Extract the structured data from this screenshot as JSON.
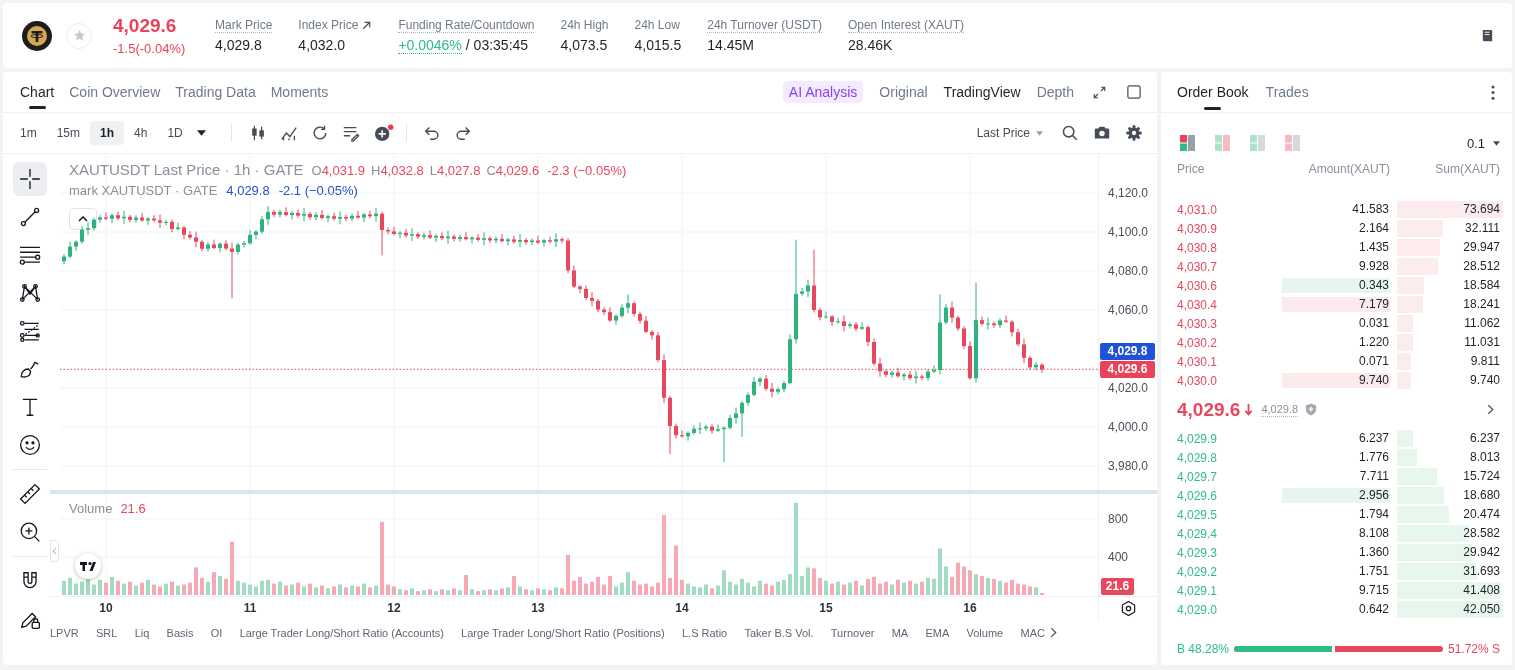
{
  "header": {
    "price": "4,029.6",
    "change": "-1.5(-0.04%)",
    "stats": [
      {
        "kind": "plain",
        "label": "Mark Price",
        "value": "4,029.8",
        "underlined": true
      },
      {
        "kind": "link",
        "label": "Index Price",
        "value": "4,032.0",
        "underlined": false
      },
      {
        "kind": "funding",
        "label": "Funding Rate/Countdown",
        "rate": "+0.0046%",
        "countdown": "/ 03:35:45",
        "underlined": true
      },
      {
        "kind": "plain",
        "label": "24h High",
        "value": "4,073.5",
        "underlined": false
      },
      {
        "kind": "plain",
        "label": "24h Low",
        "value": "4,015.5",
        "underlined": false
      },
      {
        "kind": "plain",
        "label": "24h Turnover (USDT)",
        "value": "14.45M",
        "underlined": true
      },
      {
        "kind": "plain",
        "label": "Open Interest (XAUT)",
        "value": "28.46K",
        "underlined": true
      }
    ]
  },
  "chart_panel": {
    "tabs": [
      {
        "label": "Chart",
        "selected": true
      },
      {
        "label": "Coin Overview",
        "selected": false
      },
      {
        "label": "Trading Data",
        "selected": false
      },
      {
        "label": "Moments",
        "selected": false
      }
    ],
    "ai_button": "AI Analysis",
    "views": [
      {
        "label": "Original",
        "selected": false
      },
      {
        "label": "TradingView",
        "selected": true
      },
      {
        "label": "Depth",
        "selected": false
      }
    ],
    "intervals": [
      {
        "label": "1m",
        "selected": false
      },
      {
        "label": "15m",
        "selected": false
      },
      {
        "label": "1h",
        "selected": true
      },
      {
        "label": "4h",
        "selected": false
      },
      {
        "label": "1D",
        "selected": false
      }
    ],
    "price_source": "Last Price",
    "left_tool_groups": [
      [
        {
          "kind": "crosshair",
          "selected": true
        },
        {
          "kind": "trend-line",
          "selected": false
        },
        {
          "kind": "horizontal-lines",
          "selected": false
        },
        {
          "kind": "pattern",
          "selected": false
        },
        {
          "kind": "fib-levels",
          "selected": false
        },
        {
          "kind": "brush",
          "selected": false
        },
        {
          "kind": "text",
          "selected": false
        },
        {
          "kind": "emoji",
          "selected": false
        }
      ],
      [
        {
          "kind": "ruler",
          "selected": false
        },
        {
          "kind": "zoom-in",
          "selected": false
        }
      ],
      [
        {
          "kind": "magnet",
          "selected": false
        },
        {
          "kind": "lock-drawing",
          "selected": false
        }
      ]
    ],
    "legend": {
      "ohlc": [
        {
          "key": "O",
          "value": "4,031.9"
        },
        {
          "key": "H",
          "value": "4,032.8"
        },
        {
          "key": "L",
          "value": "4,027.8"
        },
        {
          "key": "C",
          "value": "4,029.6"
        }
      ],
      "change": "-2.3 (−0.05%)",
      "mark_title": "mark XAUTUSDT · GATE",
      "mark_value": "4,029.8",
      "mark_change": "-2.1 (−0.05%)"
    },
    "price_chart": {
      "chart_data": {
        "type": "candlestick",
        "title": "XAUTUSDT Last Price · 1h · GATE",
        "grid": true,
        "categories": [
          null,
          null,
          null,
          null,
          null,
          null,
          null,
          null,
          null,
          null,
          null,
          null,
          null,
          null,
          null,
          null,
          null,
          null,
          null,
          null,
          null,
          null,
          null,
          null,
          null,
          null,
          null,
          null,
          null,
          null,
          null,
          null,
          null,
          null,
          null,
          null,
          null,
          null,
          null,
          null,
          null,
          null,
          null,
          null,
          null,
          null,
          null,
          null,
          null,
          null,
          null,
          null,
          null,
          null,
          null,
          null,
          null,
          null,
          null,
          null,
          null,
          null,
          null,
          null,
          null,
          null,
          null,
          null,
          null,
          null,
          null,
          null,
          null,
          null,
          null,
          null,
          null,
          null,
          null,
          null,
          null,
          null,
          null,
          null,
          null,
          null,
          null,
          null,
          null,
          null,
          null,
          null,
          null,
          null,
          null,
          null,
          null,
          null,
          null,
          null,
          null,
          null,
          null,
          null,
          null,
          null,
          null,
          null,
          null,
          null,
          null,
          null,
          null,
          null,
          null,
          null,
          null,
          null,
          null,
          null,
          null,
          null,
          null,
          null,
          null,
          null,
          null,
          null,
          null,
          null,
          null,
          null,
          null,
          null,
          null,
          null,
          null,
          null,
          null,
          null,
          null,
          null,
          null,
          null,
          null,
          null,
          null,
          null,
          null,
          null,
          null,
          null,
          null,
          null,
          null,
          null,
          null,
          null,
          null,
          null,
          null,
          null,
          null,
          null
        ],
        "ylim": [
          3967.7,
          4140
        ],
        "yticks": [
          {
            "value": 4120,
            "label": "4,120.0"
          },
          {
            "value": 4100,
            "label": "4,100.0"
          },
          {
            "value": 4080,
            "label": "4,080.0"
          },
          {
            "value": 4060,
            "label": "4,060.0"
          },
          {
            "value": 4020,
            "label": "4,020.0"
          },
          {
            "value": 4000,
            "label": "4,000.0"
          },
          {
            "value": 3980,
            "label": "3,980.0"
          }
        ],
        "ref_lines": [
          {
            "axis": "y",
            "value": 4029.6,
            "label": "4,029.6",
            "color": "#e94359"
          }
        ],
        "ohlc": [
          [
            4085.0,
            4088.6,
            4083.5,
            4087.4
          ],
          [
            4087.4,
            4095.0,
            4086.7,
            4092.5
          ],
          [
            4092.5,
            4095.8,
            4090.3,
            4095.0
          ],
          [
            4095.0,
            4103.0,
            4094.0,
            4101.2
          ],
          [
            4101.2,
            4105.0,
            4098.4,
            4102.0
          ],
          [
            4102.0,
            4107.3,
            4100.7,
            4106.3
          ],
          [
            4106.3,
            4108.7,
            4104.8,
            4107.5
          ],
          [
            4107.5,
            4110.0,
            4106.1,
            4106.8
          ],
          [
            4106.8,
            4109.4,
            4104.6,
            4108.6
          ],
          [
            4108.6,
            4110.4,
            4106.0,
            4107.0
          ],
          [
            4107.0,
            4110.8,
            4104.2,
            4107.8
          ],
          [
            4107.8,
            4108.8,
            4104.9,
            4106.2
          ],
          [
            4106.2,
            4108.6,
            4104.7,
            4107.4
          ],
          [
            4107.4,
            4109.9,
            4105.2,
            4105.9
          ],
          [
            4105.9,
            4107.7,
            4103.7,
            4106.9
          ],
          [
            4106.9,
            4108.7,
            4105.0,
            4106.0
          ],
          [
            4106.0,
            4109.0,
            4102.0,
            4104.8
          ],
          [
            4104.8,
            4106.2,
            4103.5,
            4105.2
          ],
          [
            4105.2,
            4106.4,
            4100.0,
            4101.5
          ],
          [
            4101.5,
            4104.8,
            4100.8,
            4102.3
          ],
          [
            4102.3,
            4103.1,
            4096.4,
            4098.6
          ],
          [
            4098.6,
            4100.4,
            4096.2,
            4097.2
          ],
          [
            4097.2,
            4100.2,
            4092.2,
            4095.0
          ],
          [
            4095.0,
            4096.0,
            4090.1,
            4091.4
          ],
          [
            4091.4,
            4094.8,
            4089.9,
            4093.6
          ],
          [
            4093.6,
            4096.1,
            4091.1,
            4091.8
          ],
          [
            4091.8,
            4094.8,
            4089.6,
            4094.0
          ],
          [
            4094.0,
            4095.8,
            4090.5,
            4091.5
          ],
          [
            4091.5,
            4094.5,
            4066.0,
            4089.8
          ],
          [
            4089.8,
            4094.5,
            4088.5,
            4093.5
          ],
          [
            4093.5,
            4095.4,
            4092.0,
            4094.2
          ],
          [
            4094.2,
            4101.0,
            4093.5,
            4098.5
          ],
          [
            4098.5,
            4101.0,
            4096.3,
            4100.2
          ],
          [
            4100.2,
            4108.3,
            4099.2,
            4106.5
          ],
          [
            4106.5,
            4113.3,
            4103.7,
            4110.3
          ],
          [
            4110.3,
            4111.3,
            4107.6,
            4108.9
          ],
          [
            4108.9,
            4111.4,
            4107.4,
            4110.2
          ],
          [
            4110.2,
            4112.7,
            4108.0,
            4108.7
          ],
          [
            4108.7,
            4110.6,
            4106.5,
            4109.8
          ],
          [
            4109.8,
            4111.6,
            4107.4,
            4108.4
          ],
          [
            4108.4,
            4112.3,
            4105.6,
            4109.3
          ],
          [
            4109.3,
            4110.3,
            4106.3,
            4107.6
          ],
          [
            4107.6,
            4110.0,
            4106.1,
            4108.8
          ],
          [
            4108.8,
            4111.3,
            4106.5,
            4107.2
          ],
          [
            4107.2,
            4108.9,
            4105.0,
            4108.1
          ],
          [
            4108.1,
            4109.9,
            4105.8,
            4106.8
          ],
          [
            4106.8,
            4110.7,
            4104.0,
            4107.7
          ],
          [
            4107.7,
            4108.7,
            4105.6,
            4106.9
          ],
          [
            4106.9,
            4109.5,
            4105.4,
            4108.3
          ],
          [
            4108.3,
            4110.8,
            4106.7,
            4107.4
          ],
          [
            4107.4,
            4109.8,
            4105.2,
            4109.0
          ],
          [
            4109.0,
            4110.8,
            4107.1,
            4108.1
          ],
          [
            4108.1,
            4112.4,
            4105.3,
            4109.4
          ],
          [
            4109.4,
            4110.4,
            4088.0,
            4101.0
          ],
          [
            4101.0,
            4102.2,
            4098.8,
            4100.3
          ],
          [
            4100.3,
            4102.8,
            4098.3,
            4099.0
          ],
          [
            4099.0,
            4100.4,
            4096.8,
            4099.6
          ],
          [
            4099.6,
            4101.4,
            4097.2,
            4098.2
          ],
          [
            4098.2,
            4101.9,
            4095.4,
            4098.9
          ],
          [
            4098.9,
            4099.9,
            4096.3,
            4097.6
          ],
          [
            4097.6,
            4099.6,
            4096.1,
            4098.4
          ],
          [
            4098.4,
            4100.9,
            4096.4,
            4097.1
          ],
          [
            4097.1,
            4098.8,
            4094.9,
            4098.0
          ],
          [
            4098.0,
            4099.8,
            4095.8,
            4096.8
          ],
          [
            4096.8,
            4100.7,
            4094.0,
            4097.7
          ],
          [
            4097.7,
            4098.7,
            4095.2,
            4096.5
          ],
          [
            4096.5,
            4098.6,
            4095.0,
            4097.4
          ],
          [
            4097.4,
            4099.9,
            4095.6,
            4096.3
          ],
          [
            4096.3,
            4097.9,
            4094.1,
            4097.1
          ],
          [
            4097.1,
            4098.9,
            4095.0,
            4096.0
          ],
          [
            4096.0,
            4099.8,
            4093.2,
            4096.8
          ],
          [
            4096.8,
            4097.8,
            4094.4,
            4095.7
          ],
          [
            4095.7,
            4097.7,
            4094.2,
            4096.5
          ],
          [
            4096.5,
            4099.0,
            4094.6,
            4095.3
          ],
          [
            4095.3,
            4097.0,
            4093.1,
            4096.2
          ],
          [
            4096.2,
            4098.0,
            4094.0,
            4095.0
          ],
          [
            4095.0,
            4098.9,
            4092.2,
            4095.9
          ],
          [
            4095.9,
            4096.9,
            4093.5,
            4094.8
          ],
          [
            4094.8,
            4096.8,
            4093.3,
            4095.6
          ],
          [
            4095.6,
            4098.1,
            4093.9,
            4094.6
          ],
          [
            4094.6,
            4096.6,
            4092.4,
            4095.8
          ],
          [
            4095.8,
            4097.6,
            4094.1,
            4095.1
          ],
          [
            4095.1,
            4099.3,
            4092.3,
            4096.3
          ],
          [
            4096.3,
            4097.3,
            4094.3,
            4095.6
          ],
          [
            4095.6,
            4096.8,
            4078.8,
            4080.3
          ],
          [
            4080.3,
            4082.8,
            4071.3,
            4072.0
          ],
          [
            4072.0,
            4072.8,
            4068.6,
            4070.8
          ],
          [
            4070.8,
            4072.6,
            4065.2,
            4066.2
          ],
          [
            4066.2,
            4069.2,
            4061.9,
            4064.7
          ],
          [
            4064.7,
            4065.7,
            4058.9,
            4060.2
          ],
          [
            4060.2,
            4061.4,
            4057.4,
            4058.9
          ],
          [
            4058.9,
            4061.4,
            4053.9,
            4054.6
          ],
          [
            4054.6,
            4057.8,
            4052.4,
            4057.0
          ],
          [
            4057.0,
            4063.0,
            4056.0,
            4061.2
          ],
          [
            4061.2,
            4068.0,
            4058.4,
            4063.5
          ],
          [
            4063.5,
            4064.5,
            4056.7,
            4058.0
          ],
          [
            4058.0,
            4059.2,
            4053.0,
            4054.5
          ],
          [
            4054.5,
            4057.0,
            4048.1,
            4048.8
          ],
          [
            4048.8,
            4049.6,
            4044.8,
            4047.0
          ],
          [
            4047.0,
            4048.8,
            4033.3,
            4034.3
          ],
          [
            4034.3,
            4037.3,
            4012.2,
            4015.0
          ],
          [
            4015.0,
            4016.0,
            3986.0,
            4000.5
          ],
          [
            4000.5,
            4001.7,
            3994.3,
            3995.8
          ],
          [
            3995.8,
            3998.3,
            3994.5,
            3995.2
          ],
          [
            3995.2,
            3997.8,
            3993.0,
            3997.0
          ],
          [
            3997.0,
            4000.9,
            3996.0,
            3999.1
          ],
          [
            3999.1,
            4002.3,
            3996.3,
            3999.3
          ],
          [
            3999.3,
            4001.2,
            3998.0,
            4000.2
          ],
          [
            4000.2,
            4001.4,
            3996.6,
            3998.1
          ],
          [
            3998.1,
            4001.4,
            3997.4,
            3998.9
          ],
          [
            3998.9,
            4000.4,
            3982.0,
            3999.6
          ],
          [
            3999.6,
            4006.4,
            3998.6,
            4004.6
          ],
          [
            4004.6,
            4010.0,
            4001.8,
            4007.0
          ],
          [
            4007.0,
            4013.4,
            3995.0,
            4012.4
          ],
          [
            4012.4,
            4017.7,
            4010.9,
            4016.5
          ],
          [
            4016.5,
            4025.7,
            4015.8,
            4023.2
          ],
          [
            4023.2,
            4025.6,
            4021.0,
            4024.8
          ],
          [
            4024.8,
            4026.6,
            4018.6,
            4019.6
          ],
          [
            4019.6,
            4022.6,
            4015.3,
            4018.1
          ],
          [
            4018.1,
            4020.4,
            4016.8,
            4019.4
          ],
          [
            4019.4,
            4023.7,
            4017.9,
            4022.5
          ],
          [
            4022.5,
            4047.5,
            4021.8,
            4045.0
          ],
          [
            4045.0,
            4096.0,
            4042.8,
            4068.3
          ],
          [
            4068.3,
            4071.3,
            4067.3,
            4069.5
          ],
          [
            4069.5,
            4075.6,
            4066.7,
            4072.6
          ],
          [
            4072.6,
            4091.0,
            4058.7,
            4060.0
          ],
          [
            4060.0,
            4061.2,
            4054.7,
            4056.2
          ],
          [
            4056.2,
            4059.2,
            4055.5,
            4056.7
          ],
          [
            4056.7,
            4057.5,
            4051.7,
            4053.9
          ],
          [
            4053.9,
            4056.0,
            4052.9,
            4054.2
          ],
          [
            4054.2,
            4057.2,
            4049.0,
            4051.8
          ],
          [
            4051.8,
            4053.6,
            4050.5,
            4052.6
          ],
          [
            4052.6,
            4053.8,
            4048.9,
            4050.4
          ],
          [
            4050.4,
            4053.7,
            4049.7,
            4051.2
          ],
          [
            4051.2,
            4052.0,
            4041.4,
            4043.6
          ],
          [
            4043.6,
            4045.4,
            4031.5,
            4032.5
          ],
          [
            4032.5,
            4035.5,
            4025.8,
            4028.6
          ],
          [
            4028.6,
            4029.6,
            4025.5,
            4026.8
          ],
          [
            4026.8,
            4029.1,
            4025.3,
            4027.9
          ],
          [
            4027.9,
            4030.4,
            4025.3,
            4026.0
          ],
          [
            4026.0,
            4027.7,
            4023.8,
            4026.9
          ],
          [
            4026.9,
            4028.7,
            4024.1,
            4025.1
          ],
          [
            4025.1,
            4028.9,
            4022.3,
            4025.9
          ],
          [
            4025.9,
            4026.9,
            4023.9,
            4025.2
          ],
          [
            4025.2,
            4029.6,
            4023.7,
            4028.4
          ],
          [
            4028.4,
            4031.7,
            4027.7,
            4029.2
          ],
          [
            4029.2,
            4068.0,
            4027.0,
            4053.6
          ],
          [
            4053.6,
            4063.1,
            4052.6,
            4061.3
          ],
          [
            4061.3,
            4064.3,
            4053.3,
            4056.1
          ],
          [
            4056.1,
            4057.1,
            4049.2,
            4050.5
          ],
          [
            4050.5,
            4051.7,
            4040.0,
            4041.5
          ],
          [
            4041.5,
            4044.0,
            4024.3,
            4025.0
          ],
          [
            4025.0,
            4074.0,
            4022.8,
            4054.8
          ],
          [
            4054.8,
            4056.6,
            4051.9,
            4052.9
          ],
          [
            4052.9,
            4056.1,
            4050.1,
            4053.1
          ],
          [
            4053.1,
            4054.1,
            4050.9,
            4052.2
          ],
          [
            4052.2,
            4055.8,
            4050.7,
            4054.6
          ],
          [
            4054.6,
            4057.1,
            4053.3,
            4054.0
          ],
          [
            4054.0,
            4054.8,
            4046.4,
            4048.6
          ],
          [
            4048.6,
            4050.4,
            4041.4,
            4042.4
          ],
          [
            4042.4,
            4045.4,
            4032.7,
            4035.5
          ],
          [
            4035.5,
            4036.5,
            4029.3,
            4030.6
          ],
          [
            4030.6,
            4033.1,
            4029.1,
            4031.9
          ],
          [
            4031.9,
            4032.8,
            4027.8,
            4029.6
          ]
        ]
      }
    },
    "mark_price_tag": "4,029.8",
    "volume_chart": {
      "value": "21.6",
      "tag": "21.6",
      "chart_data": {
        "type": "bar",
        "title": "Volume",
        "grid": true,
        "categories": [
          null,
          null,
          null,
          null,
          null,
          null,
          null,
          "10",
          null,
          null,
          null,
          null,
          null,
          null,
          null,
          null,
          null,
          null,
          null,
          null,
          null,
          null,
          null,
          null,
          null,
          null,
          null,
          null,
          null,
          null,
          null,
          "11",
          null,
          null,
          null,
          null,
          null,
          null,
          null,
          null,
          null,
          null,
          null,
          null,
          null,
          null,
          null,
          null,
          null,
          null,
          null,
          null,
          null,
          null,
          null,
          "12",
          null,
          null,
          null,
          null,
          null,
          null,
          null,
          null,
          null,
          null,
          null,
          null,
          null,
          null,
          null,
          null,
          null,
          null,
          null,
          null,
          null,
          null,
          null,
          "13",
          null,
          null,
          null,
          null,
          null,
          null,
          null,
          null,
          null,
          null,
          null,
          null,
          null,
          null,
          null,
          null,
          null,
          null,
          null,
          null,
          null,
          null,
          null,
          "14",
          null,
          null,
          null,
          null,
          null,
          null,
          null,
          null,
          null,
          null,
          null,
          null,
          null,
          null,
          null,
          null,
          null,
          null,
          null,
          null,
          null,
          null,
          null,
          "15",
          null,
          null,
          null,
          null,
          null,
          null,
          null,
          null,
          null,
          null,
          null,
          null,
          null,
          null,
          null,
          null,
          null,
          null,
          null,
          null,
          null,
          null,
          null,
          "16",
          null,
          null,
          null,
          null,
          null,
          null,
          null,
          null,
          null,
          null,
          null,
          null
        ],
        "ylim": [
          0,
          1063
        ],
        "yticks": [
          {
            "value": 800,
            "label": "800"
          },
          {
            "value": 400,
            "label": "400"
          }
        ],
        "values": [
          150,
          180,
          120,
          140,
          170,
          110,
          160,
          130,
          190,
          150,
          120,
          140,
          100,
          130,
          160,
          110,
          90,
          120,
          140,
          100,
          110,
          130,
          290,
          180,
          140,
          240,
          200,
          170,
          560,
          150,
          130,
          110,
          90,
          150,
          160,
          120,
          140,
          100,
          110,
          130,
          90,
          120,
          80,
          100,
          70,
          90,
          110,
          80,
          100,
          90,
          120,
          80,
          100,
          770,
          110,
          90,
          60,
          50,
          70,
          40,
          50,
          60,
          40,
          60,
          50,
          70,
          50,
          210,
          60,
          40,
          50,
          60,
          50,
          70,
          80,
          200,
          90,
          60,
          50,
          70,
          60,
          50,
          80,
          70,
          420,
          150,
          190,
          120,
          140,
          190,
          110,
          200,
          90,
          130,
          240,
          150,
          110,
          120,
          90,
          130,
          840,
          180,
          520,
          160,
          120,
          90,
          80,
          110,
          70,
          100,
          260,
          140,
          110,
          170,
          130,
          90,
          150,
          120,
          100,
          140,
          160,
          220,
          970,
          200,
          290,
          280,
          180,
          150,
          120,
          140,
          110,
          130,
          150,
          100,
          170,
          190,
          120,
          140,
          110,
          160,
          130,
          150,
          120,
          140,
          180,
          170,
          490,
          300,
          190,
          340,
          300,
          260,
          220,
          200,
          180,
          170,
          150,
          130,
          160,
          120,
          110,
          90,
          80,
          21.6
        ]
      }
    },
    "indicators": [
      "LPVR",
      "SRL",
      "Liq",
      "Basis",
      "OI",
      "Large Trader Long/Short Ratio (Accounts)",
      "Large Trader Long/Short Ratio (Positions)",
      "L.S Ratio",
      "Taker B.S Vol.",
      "Turnover",
      "MA",
      "EMA",
      "Volume",
      "MAC"
    ]
  },
  "order_book": {
    "tabs": [
      {
        "label": "Order Book",
        "selected": true
      },
      {
        "label": "Trades",
        "selected": false
      }
    ],
    "layouts": [
      {
        "kind": "both",
        "selected": true
      },
      {
        "kind": "side-by-side",
        "selected": false
      },
      {
        "kind": "bids",
        "selected": false
      },
      {
        "kind": "asks",
        "selected": false
      }
    ],
    "precision": "0.1",
    "columns": [
      "Price",
      "Amount(XAUT)",
      "Sum(XAUT)"
    ],
    "asks": [
      {
        "price": "4,031.0",
        "amount": "41.583",
        "sum": "73.694"
      },
      {
        "price": "4,030.9",
        "amount": "2.164",
        "sum": "32.111"
      },
      {
        "price": "4,030.8",
        "amount": "1.435",
        "sum": "29.947"
      },
      {
        "price": "4,030.7",
        "amount": "9.928",
        "sum": "28.512"
      },
      {
        "price": "4,030.6",
        "amount": "0.343",
        "sum": "18.584",
        "color": "#e6f5ef"
      },
      {
        "price": "4,030.4",
        "amount": "7.179",
        "sum": "18.241",
        "color": "#fbeaec"
      },
      {
        "price": "4,030.3",
        "amount": "0.031",
        "sum": "11.062"
      },
      {
        "price": "4,030.2",
        "amount": "1.220",
        "sum": "11.031"
      },
      {
        "price": "4,030.1",
        "amount": "0.071",
        "sum": "9.811"
      },
      {
        "price": "4,030.0",
        "amount": "9.740",
        "sum": "9.740",
        "color": "#fbeaec"
      }
    ],
    "last_price": "4,029.6",
    "falling": true,
    "mark_price": "4,029.8",
    "bids": [
      {
        "price": "4,029.9",
        "amount": "6.237",
        "sum": "6.237"
      },
      {
        "price": "4,029.8",
        "amount": "1.776",
        "sum": "8.013"
      },
      {
        "price": "4,029.7",
        "amount": "7.711",
        "sum": "15.724"
      },
      {
        "price": "4,029.6",
        "amount": "2.956",
        "sum": "18.680",
        "color": "#e6f5ef"
      },
      {
        "price": "4,029.5",
        "amount": "1.794",
        "sum": "20.474"
      },
      {
        "price": "4,029.4",
        "amount": "8.108",
        "sum": "28.582"
      },
      {
        "price": "4,029.3",
        "amount": "1.360",
        "sum": "29.942"
      },
      {
        "price": "4,029.2",
        "amount": "1.751",
        "sum": "31.693"
      },
      {
        "price": "4,029.1",
        "amount": "9.715",
        "sum": "41.408"
      },
      {
        "price": "4,029.0",
        "amount": "0.642",
        "sum": "42.050"
      }
    ],
    "ratio": {
      "buy": "B 48.28%",
      "sell": "51.72% S",
      "level": 0.4828
    }
  }
}
